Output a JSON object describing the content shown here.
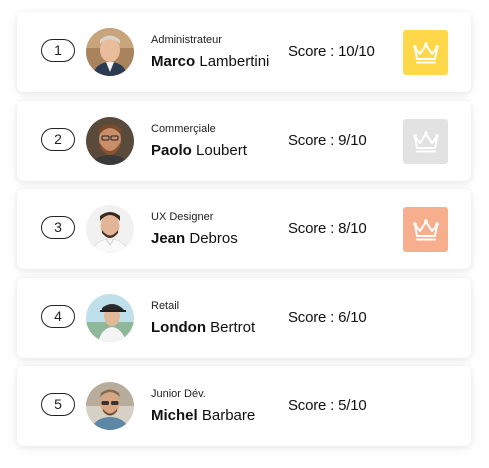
{
  "leaderboard": [
    {
      "rank": "1",
      "role": "Administrateur",
      "first_name": "Marco",
      "last_name": "Lambertini",
      "score": "Score : 10/10",
      "badge_color": "#FFD84A",
      "badge_icon": "crown-icon",
      "avatar_icon": "avatar-photo-marco"
    },
    {
      "rank": "2",
      "role": "Commerçiale",
      "first_name": "Paolo",
      "last_name": "Loubert",
      "score": "Score : 9/10",
      "badge_color": "#E2E2E2",
      "badge_icon": "crown-icon",
      "avatar_icon": "avatar-photo-paolo"
    },
    {
      "rank": "3",
      "role": "UX Designer",
      "first_name": "Jean",
      "last_name": "Debros",
      "score": "Score : 8/10",
      "badge_color": "#F7AE8C",
      "badge_icon": "crown-icon",
      "avatar_icon": "avatar-photo-jean"
    },
    {
      "rank": "4",
      "role": "Retail",
      "first_name": "London",
      "last_name": "Bertrot",
      "score": "Score : 6/10",
      "badge_color": null,
      "avatar_icon": "avatar-photo-london"
    },
    {
      "rank": "5",
      "role": "Junior Dév.",
      "first_name": "Michel",
      "last_name": "Barbare",
      "score": "Score : 5/10",
      "badge_color": null,
      "avatar_icon": "avatar-photo-michel"
    }
  ]
}
